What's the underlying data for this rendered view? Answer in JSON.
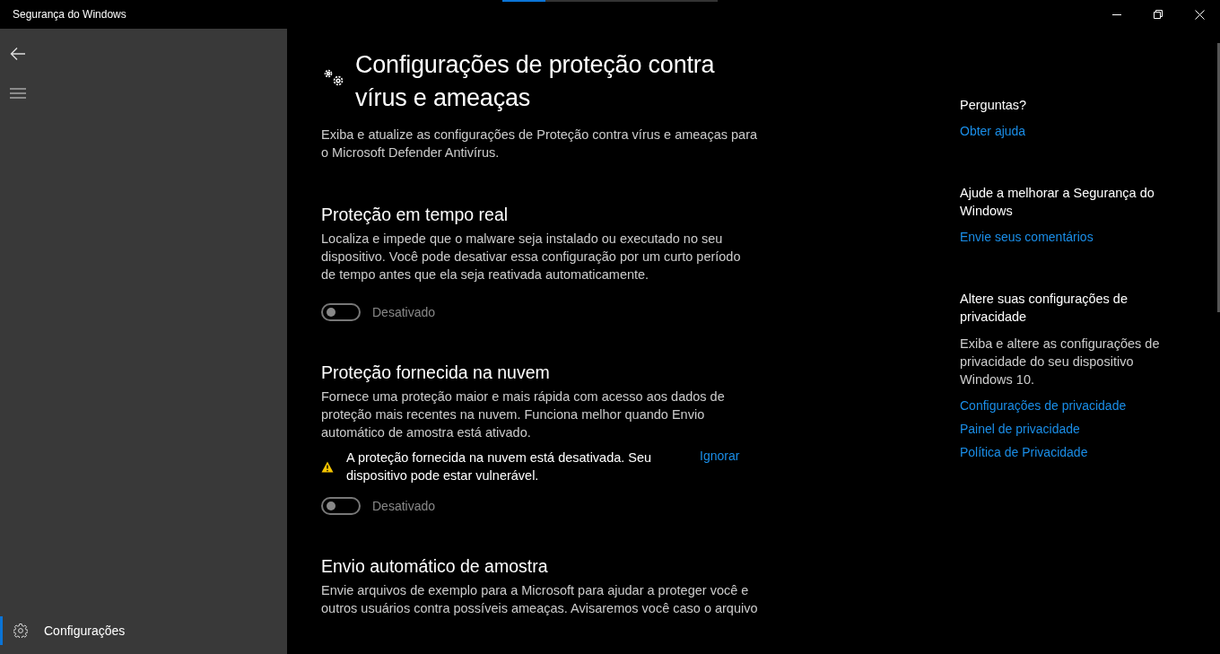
{
  "window": {
    "title": "Segurança do Windows"
  },
  "loading_bar": {
    "level": 0.2
  },
  "sidebar": {
    "items": [
      {
        "label": "Configurações",
        "selected": true
      }
    ]
  },
  "page": {
    "title_lines": [
      "Configurações de proteção contra",
      "vírus e ameaças"
    ],
    "description_lines": [
      "Exiba e atualize as configurações de Proteção contra vírus e ameaças para",
      "o Microsoft Defender Antivírus."
    ]
  },
  "sections": [
    {
      "title": "Proteção em tempo real",
      "description_lines": [
        "Localiza e impede que o malware seja instalado ou executado no seu",
        "dispositivo. Você pode desativar essa configuração por um curto período",
        "de tempo antes que ela seja reativada automaticamente."
      ],
      "toggle": {
        "on": false,
        "label": "Desativado"
      }
    },
    {
      "title": "Proteção fornecida na nuvem",
      "description_lines": [
        "Fornece uma proteção maior e mais rápida com acesso aos dados de",
        "proteção mais recentes na nuvem. Funciona melhor quando Envio",
        "automático de amostra está ativado."
      ],
      "warning": {
        "lines": [
          "A proteção fornecida na nuvem está desativada. Seu",
          "dispositivo pode estar vulnerável."
        ],
        "action": "Ignorar"
      },
      "toggle": {
        "on": false,
        "label": "Desativado"
      }
    },
    {
      "title": "Envio automático de amostra",
      "description_lines": [
        "Envie arquivos de exemplo para a Microsoft para ajudar a proteger você e",
        "outros usuários contra possíveis ameaças. Avisaremos você caso o arquivo"
      ]
    }
  ],
  "aside": [
    {
      "heading_lines": [
        "Perguntas?"
      ],
      "links": [
        "Obter ajuda"
      ]
    },
    {
      "heading_lines": [
        "Ajude a melhorar a Segurança do",
        "Windows"
      ],
      "links": [
        "Envie seus comentários"
      ]
    },
    {
      "heading_lines": [
        "Altere suas configurações de",
        "privacidade"
      ],
      "text_lines": [
        "Exiba e altere as configurações de",
        "privacidade do seu dispositivo",
        "Windows 10."
      ],
      "links": [
        "Configurações de privacidade",
        "Painel de privacidade",
        "Política de Privacidade"
      ]
    }
  ]
}
